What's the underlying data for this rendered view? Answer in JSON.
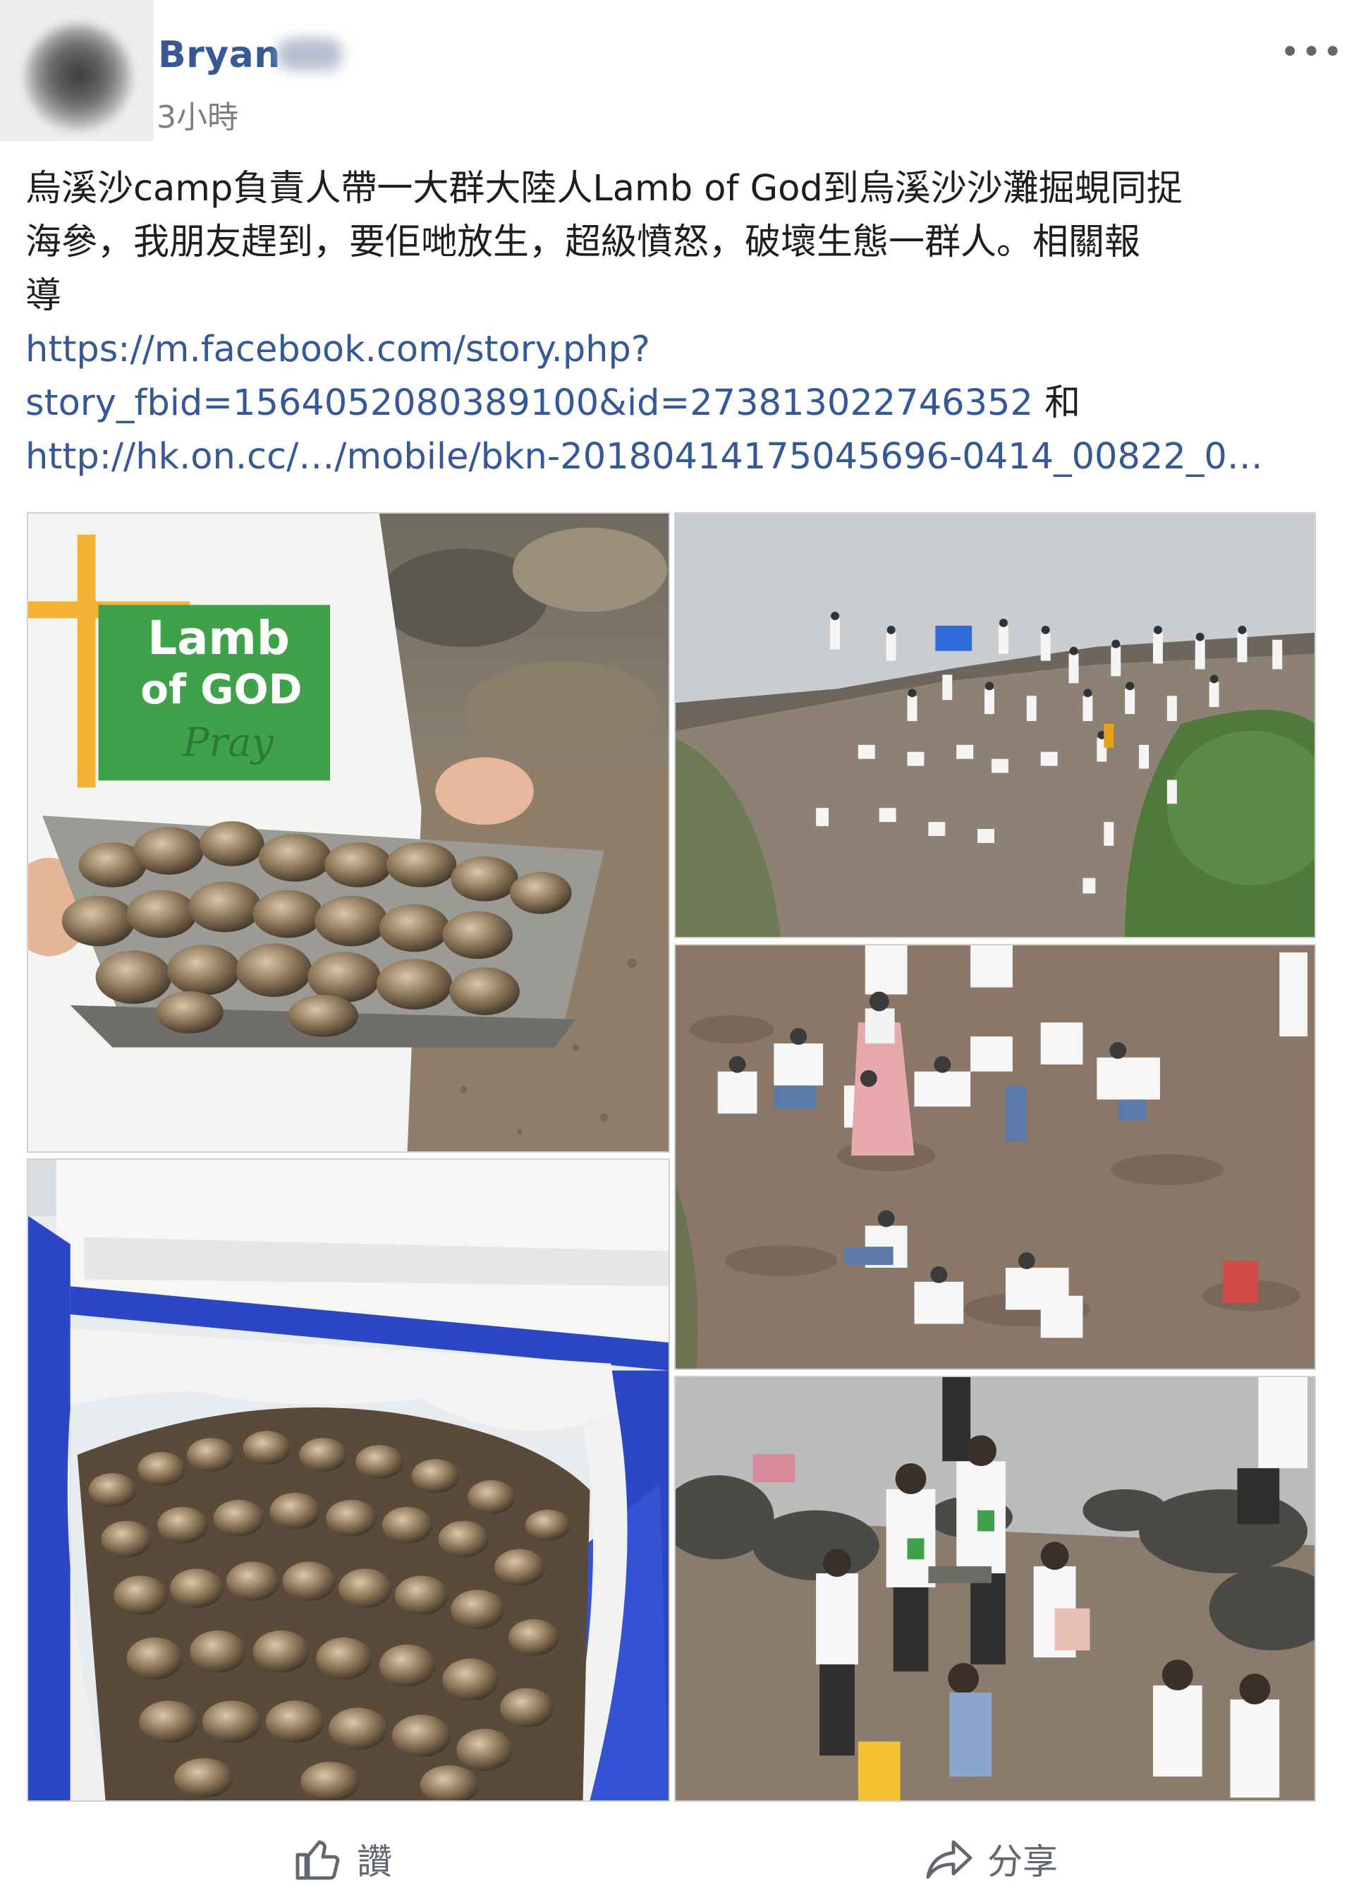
{
  "post": {
    "author": "Bryan",
    "timestamp": "3小時",
    "more_label": "•••",
    "text_lines": [
      "烏溪沙camp負責人帶一大群大陸人Lamb of God到烏溪沙沙灘掘蜆同捉",
      "海參，我朋友趕到，要佢哋放生，超級憤怒，破壞生態一群人。相關報",
      "導"
    ],
    "link1_line1": "https://m.facebook.com/story.php?",
    "link1_line2": "story_fbid=1564052080389100&id=273813022746352",
    "connector": " 和",
    "link2": "http://hk.on.cc/…/mobile/bkn-20180414175045696-0414_00822_0…",
    "tshirt_text_1": "Lamb",
    "tshirt_text_2": "of GOD",
    "tshirt_text_3": "Pray"
  },
  "actions": {
    "like_label": "讚",
    "share_label": "分享"
  },
  "colors": {
    "author_link": "#365899",
    "link": "#365899",
    "muted": "#606770",
    "tshirt_green": "#3fa24a",
    "tshirt_cross": "#f2b233",
    "cooler_blue": "#2b47c6"
  }
}
